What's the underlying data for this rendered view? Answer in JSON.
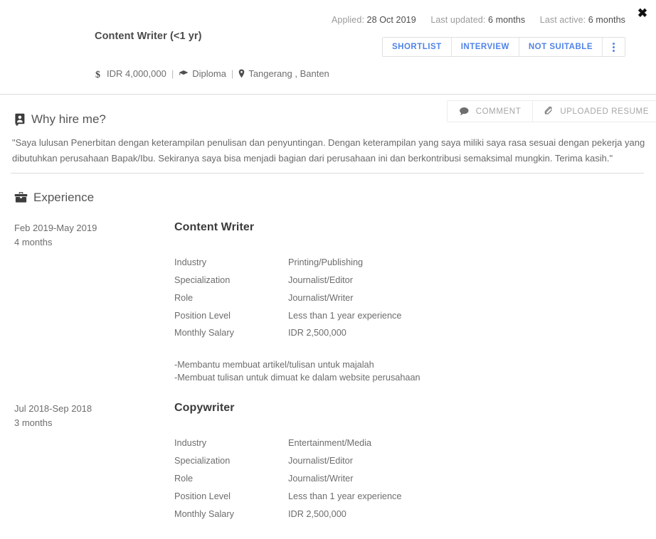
{
  "header": {
    "close_label": "✖",
    "meta": [
      {
        "label": "Applied:",
        "value": "28 Oct 2019"
      },
      {
        "label": "Last updated:",
        "value": "6 months"
      },
      {
        "label": "Last active:",
        "value": "6 months"
      }
    ],
    "candidate_title": "Content Writer (<1 yr)",
    "facts": {
      "salary": "IDR 4,000,000",
      "education": "Diploma",
      "location": "Tangerang , Banten",
      "separator": "|"
    },
    "actions": {
      "shortlist": "SHORTLIST",
      "interview": "INTERVIEW",
      "not_suitable": "NOT SUITABLE"
    }
  },
  "why_hire_me": {
    "heading": "Why hire me?",
    "body": "\"Saya lulusan Penerbitan dengan keterampilan penulisan dan penyuntingan. Dengan keterampilan yang saya miliki saya rasa sesuai dengan pekerja yang dibutuhkan perusahaan Bapak/Ibu. Sekiranya saya bisa menjadi bagian dari perusahaan ini dan berkontribusi semaksimal mungkin. Terima kasih.\"",
    "tabs": {
      "comment": "COMMENT",
      "uploaded_resume": "UPLOADED RESUME"
    }
  },
  "experience": {
    "heading": "Experience",
    "field_labels": {
      "industry": "Industry",
      "specialization": "Specialization",
      "role": "Role",
      "position_level": "Position Level",
      "monthly_salary": "Monthly Salary"
    },
    "items": [
      {
        "date_range": "Feb 2019-May 2019",
        "duration": "4 months",
        "title": "Content Writer",
        "industry": "Printing/Publishing",
        "specialization": "Journalist/Editor",
        "role": "Journalist/Writer",
        "position_level": "Less than 1 year experience",
        "monthly_salary": "IDR 2,500,000",
        "description": "-Membantu membuat artikel/tulisan untuk majalah\n-Membuat tulisan untuk dimuat ke dalam website perusahaan"
      },
      {
        "date_range": "Jul 2018-Sep 2018",
        "duration": "3 months",
        "title": "Copywriter",
        "industry": "Entertainment/Media",
        "specialization": "Journalist/Editor",
        "role": "Journalist/Writer",
        "position_level": "Less than 1 year experience",
        "monthly_salary": "IDR 2,500,000",
        "description": ""
      }
    ]
  },
  "colors": {
    "accent_blue": "#4f83e8",
    "text_gray": "#6d6d6d",
    "border_gray": "#dcdcdc"
  }
}
